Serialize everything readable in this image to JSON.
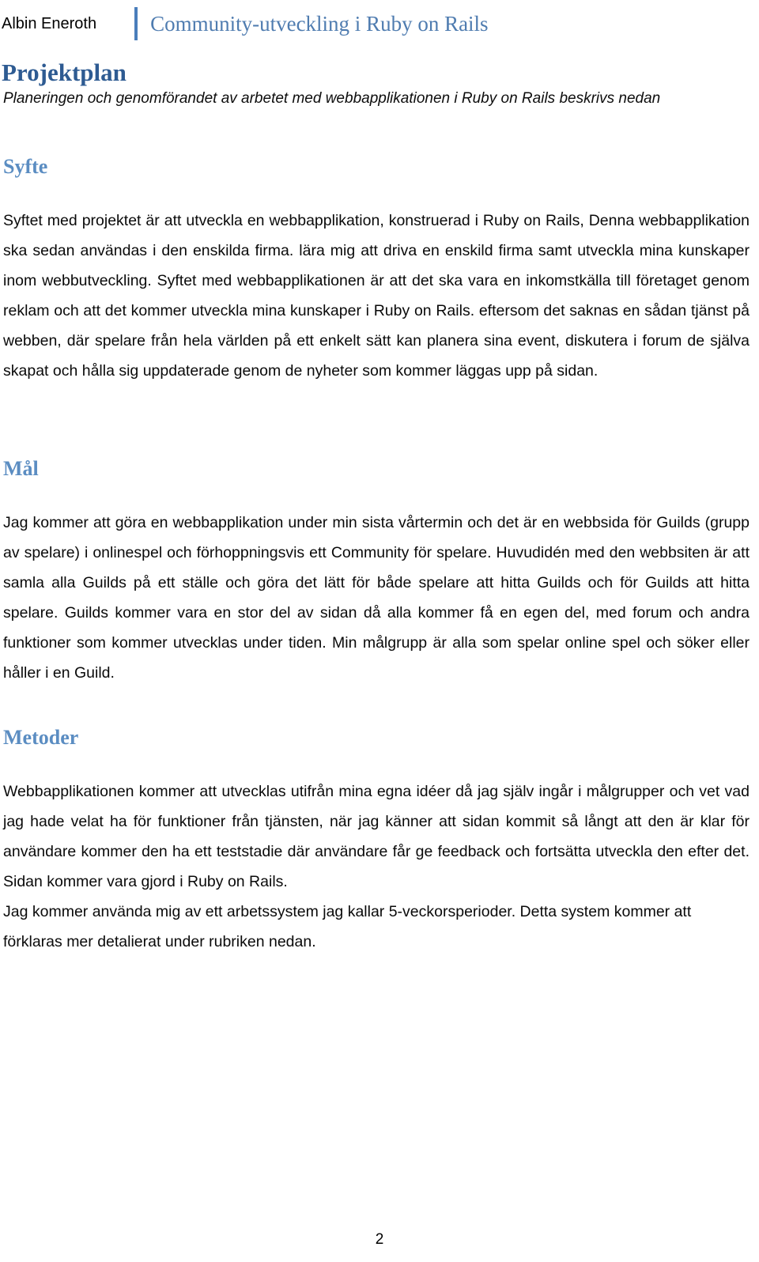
{
  "header": {
    "author": "Albin Eneroth",
    "rule_color": "#4A7EBB",
    "title": "Community-utveckling i Ruby on Rails"
  },
  "document": {
    "title": "Projektplan",
    "title_color": "#2E5B92",
    "subtitle": "Planeringen och genomförandet av arbetet med webbapplikationen i Ruby on Rails beskrivs nedan",
    "heading_color": "#5B8DC2",
    "page_number": "2"
  },
  "sections": [
    {
      "heading": "Syfte",
      "paragraphs": [
        "Syftet med projektet är att utveckla en webbapplikation, konstruerad i Ruby on Rails, Denna webbapplikation ska sedan användas i den enskilda firma. lära mig att driva en enskild firma samt utveckla mina kunskaper inom webbutveckling. Syftet med webbapplikationen är att det ska vara en inkomstkälla till företaget genom reklam och att det kommer utveckla mina kunskaper i Ruby on Rails. eftersom det saknas en sådan tjänst på webben, där spelare från hela världen på ett enkelt sätt kan planera sina event, diskutera i forum de själva skapat och hålla sig uppdaterade genom de nyheter som kommer läggas upp på sidan."
      ]
    },
    {
      "heading": "Mål",
      "paragraphs": [
        "Jag kommer att göra en webbapplikation under min sista vårtermin och det är en webbsida för Guilds (grupp av spelare) i onlinespel och förhoppningsvis ett Community för spelare. Huvudidén med den webbsiten är att samla alla Guilds på ett ställe och göra det lätt för både spelare att hitta Guilds och för Guilds att hitta spelare. Guilds kommer vara en stor del av sidan då alla kommer få en egen del, med forum och andra funktioner som kommer utvecklas under tiden. Min målgrupp är alla som spelar online spel och söker eller håller i en Guild."
      ]
    },
    {
      "heading": "Metoder",
      "paragraphs": [
        "Webbapplikationen kommer att utvecklas utifrån mina egna idéer då jag själv ingår i målgrupper och vet vad jag hade velat ha för funktioner från tjänsten, när jag känner att sidan kommit så långt att den är klar för användare kommer den ha ett teststadie där användare får ge feedback och fortsätta utveckla den efter det. Sidan kommer vara gjord i Ruby on Rails.",
        "Jag kommer använda mig av ett arbetssystem jag kallar 5-veckorsperioder. Detta system kommer att förklaras mer detalierat under rubriken nedan."
      ]
    }
  ]
}
